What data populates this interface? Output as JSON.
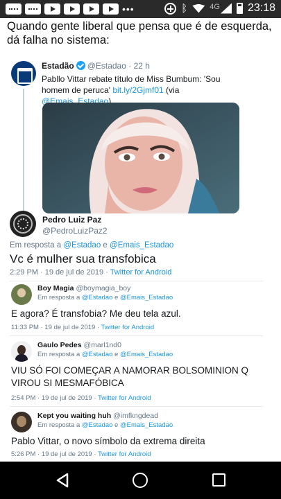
{
  "status_bar": {
    "time": "23:18",
    "network": "4G",
    "icons": [
      "message-icon",
      "message-icon",
      "youtube-icon",
      "youtube-icon",
      "youtube-icon",
      "youtube-icon",
      "more-dots-icon",
      "data-saver-icon",
      "bluetooth-icon",
      "wifi-icon",
      "signal-icon",
      "battery-icon"
    ]
  },
  "caption": "Quando gente liberal que pensa que é de esquerda, dá falha no sistema:",
  "original_tweet": {
    "name": "Estadão",
    "handle": "@Estadao",
    "time": "· 22 h",
    "text_before_link": "Pabllo Vittar rebate título de Miss Bumbum: 'Sou homem de peruca' ",
    "link": "bit.ly/2Gjmf01",
    "via_text": " (via ",
    "via_handle": "@Emais_Estadao",
    "via_close": ")"
  },
  "focus_tweet": {
    "name": "Pedro Luiz Paz",
    "handle": "@PedroLuizPaz2",
    "reply_prefix": "Em resposta a ",
    "reply_handle_1": "@Estadao",
    "reply_joiner": " e ",
    "reply_handle_2": "@Emais_Estadao",
    "text": "Vc é mulher sua transfobica",
    "meta_time": "2:29 PM · 19 de jul de 2019 · ",
    "meta_client": "Twitter for Android"
  },
  "replies": [
    {
      "name": "Boy Magia",
      "handle": "@boymagia_boy",
      "reply_prefix": "Em resposta a ",
      "reply_handle_1": "@Estadao",
      "reply_joiner": " e ",
      "reply_handle_2": "@Emais_Estadao",
      "text": "E agora? É transfobia? Me deu tela azul.",
      "meta_time": "11:33 PM · 19 de jul de 2019 · ",
      "meta_client": "Twitter for Android"
    },
    {
      "name": "Gaulo Pedes",
      "handle": "@marl1nd0",
      "reply_prefix": "Em resposta a ",
      "reply_handle_1": "@Estadao",
      "reply_joiner": " e ",
      "reply_handle_2": "@Emais_Estadao",
      "text": "VIU SÓ FOI COMEÇAR A NAMORAR BOLSOMINION Q VIROU SI MESMAFÓBICA",
      "meta_time": "2:54 PM · 19 de jul de 2019 · ",
      "meta_client": "Twitter for Android"
    },
    {
      "name": "Kept you waiting huh",
      "handle": "@imfkngdead",
      "reply_prefix": "Em resposta a ",
      "reply_handle_1": "@Estadao",
      "reply_joiner": " e ",
      "reply_handle_2": "@Emais_Estadao",
      "text": "Pablo Vittar, o novo símbolo da extrema direita",
      "meta_time": "5:26 PM · 19 de jul de 2019 · ",
      "meta_client": "Twitter for Android"
    }
  ],
  "nav_bar": {
    "icons": [
      "back-icon",
      "home-icon",
      "recents-icon"
    ]
  },
  "colors": {
    "link": "#1b95e0",
    "muted": "#657786",
    "verified": "#1da1f2",
    "status_bar": "#2a2a2a",
    "nav_bar": "#000000"
  }
}
